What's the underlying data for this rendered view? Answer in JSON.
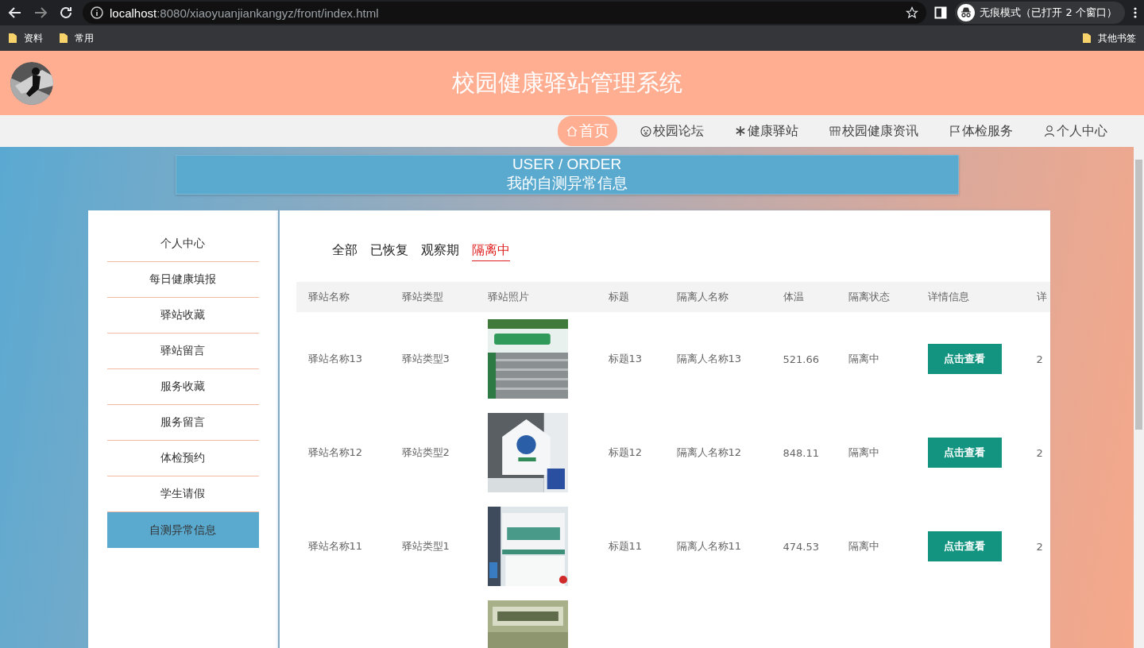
{
  "browser": {
    "url_host": "localhost",
    "url_path": ":8080/xiaoyuanjiankangyz/front/index.html",
    "profile": "无痕模式（已打开 2 个窗口）",
    "bookmarks": [
      "资料",
      "常用"
    ],
    "other_bookmarks": "其他书签"
  },
  "site": {
    "title": "校园健康驿站管理系统"
  },
  "nav": [
    {
      "label": "首页",
      "kind": "home",
      "selected": true
    },
    {
      "label": "校园论坛",
      "kind": "face",
      "selected": false
    },
    {
      "label": "健康驿站",
      "kind": "snow",
      "selected": false
    },
    {
      "label": "校园健康资讯",
      "kind": "grid",
      "selected": false
    },
    {
      "label": "体检服务",
      "kind": "flag",
      "selected": false
    },
    {
      "label": "个人中心",
      "kind": "user",
      "selected": false
    }
  ],
  "banner": {
    "title": "USER / ORDER",
    "subtitle": "我的自测异常信息"
  },
  "sidebar": [
    {
      "label": "个人中心",
      "selected": false
    },
    {
      "label": "每日健康填报",
      "selected": false
    },
    {
      "label": "驿站收藏",
      "selected": false
    },
    {
      "label": "驿站留言",
      "selected": false
    },
    {
      "label": "服务收藏",
      "selected": false
    },
    {
      "label": "服务留言",
      "selected": false
    },
    {
      "label": "体检预约",
      "selected": false
    },
    {
      "label": "学生请假",
      "selected": false
    },
    {
      "label": "自测异常信息",
      "selected": true
    }
  ],
  "filters": [
    {
      "label": "全部",
      "selected": false
    },
    {
      "label": "已恢复",
      "selected": false
    },
    {
      "label": "观察期",
      "selected": false
    },
    {
      "label": "隔离中",
      "selected": true
    }
  ],
  "table": {
    "columns": [
      "驿站名称",
      "驿站类型",
      "驿站照片",
      "标题",
      "隔离人名称",
      "体温",
      "隔离状态",
      "详情信息",
      "详"
    ],
    "rows": [
      {
        "station": "驿站名称13",
        "type": "驿站类型3",
        "photo": {
          "kind": "picture"
        },
        "title": "标题13",
        "person": "隔离人名称13",
        "temperature": "521.66",
        "status": "隔离中",
        "action": "点击查看",
        "column_9": "2"
      },
      {
        "station": "驿站名称12",
        "type": "驿站类型2",
        "photo": {
          "kind": "picture"
        },
        "title": "标题12",
        "person": "隔离人名称12",
        "temperature": "848.11",
        "status": "隔离中",
        "action": "点击查看",
        "column_9": "2"
      },
      {
        "station": "驿站名称11",
        "type": "驿站类型1",
        "photo": {
          "kind": "picture"
        },
        "title": "标题11",
        "person": "隔离人名称11",
        "temperature": "474.53",
        "status": "隔离中",
        "action": "点击查看",
        "column_9": "2"
      },
      {
        "photo": {
          "kind": "picture"
        }
      }
    ]
  }
}
